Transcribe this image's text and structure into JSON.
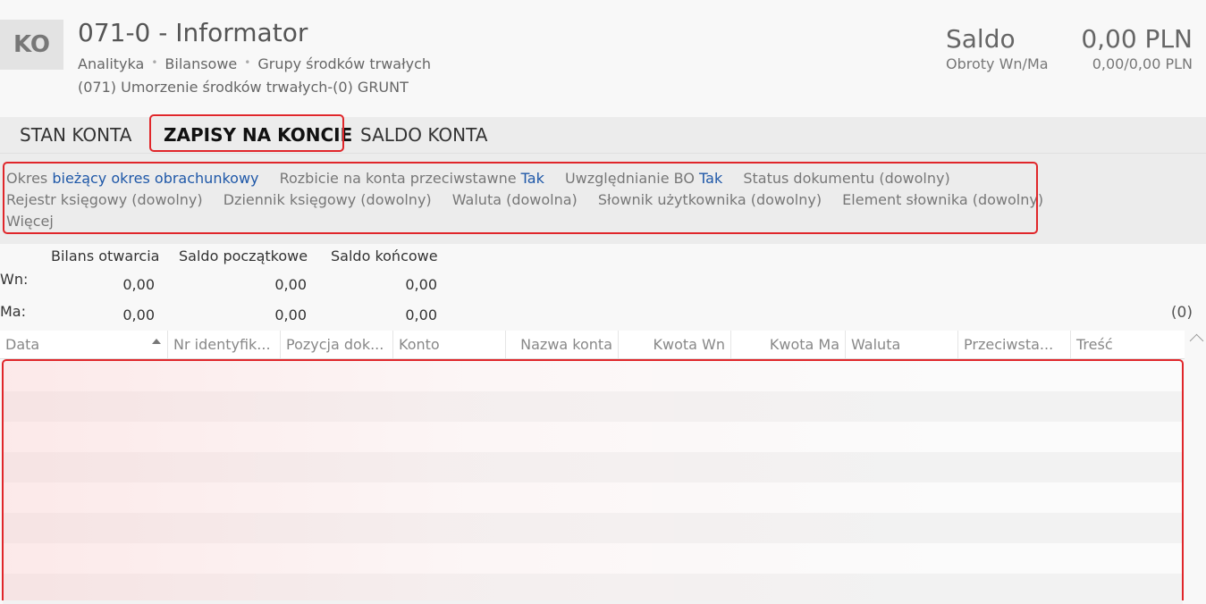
{
  "header": {
    "avatar": "KO",
    "title": "071-0 - Informator",
    "breadcrumbs": [
      "Analityka",
      "Bilansowe",
      "Grupy środków trwałych"
    ],
    "subtitle": "(071) Umorzenie środków trwałych-(0) GRUNT",
    "saldo_label": "Saldo",
    "saldo_value": "0,00 PLN",
    "obroty_label": "Obroty Wn/Ma",
    "obroty_value": "0,00/0,00 PLN"
  },
  "tabs": [
    {
      "label": "STAN KONTA",
      "active": false
    },
    {
      "label": "ZAPISY NA KONCIE",
      "active": true
    },
    {
      "label": "SALDO KONTA",
      "active": false
    }
  ],
  "filters": {
    "row1": [
      {
        "label": "Okres",
        "value": "bieżący okres obrachunkowy"
      },
      {
        "label": "Rozbicie na konta przeciwstawne",
        "value": "Tak"
      },
      {
        "label": "Uwzględnianie BO",
        "value": "Tak"
      },
      {
        "label": "Status dokumentu (dowolny)",
        "value": ""
      }
    ],
    "row2": [
      "Rejestr księgowy (dowolny)",
      "Dziennik księgowy (dowolny)",
      "Waluta (dowolna)",
      "Słownik użytkownika (dowolny)",
      "Element słownika (dowolny)"
    ],
    "more": "Więcej"
  },
  "summary": {
    "headers": [
      "Bilans otwarcia",
      "Saldo początkowe",
      "Saldo końcowe"
    ],
    "rows": [
      {
        "label": "Wn:",
        "values": [
          "0,00",
          "0,00",
          "0,00"
        ]
      },
      {
        "label": "Ma:",
        "values": [
          "0,00",
          "0,00",
          "0,00"
        ]
      }
    ],
    "count": "(0)"
  },
  "grid": {
    "columns": [
      "Data",
      "Nr identyfik...",
      "Pozycja dok...",
      "Konto",
      "Nazwa konta",
      "Kwota Wn",
      "Kwota Ma",
      "Waluta",
      "Przeciwsta...",
      "Treść"
    ],
    "sort_column": "Data",
    "sort_direction": "ascending"
  },
  "colors": {
    "highlight": "#e0262a",
    "link": "#1f58a8"
  }
}
